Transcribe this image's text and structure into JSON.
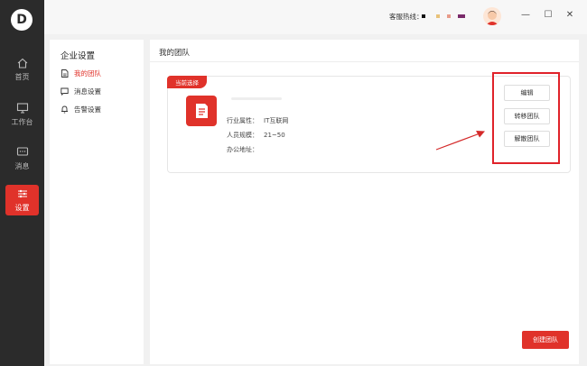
{
  "nav": {
    "items": [
      {
        "label": "首页"
      },
      {
        "label": "工作台"
      },
      {
        "label": "消息"
      },
      {
        "label": "设置"
      }
    ]
  },
  "topbar": {
    "hotline_label": "客服热线：",
    "colors": [
      "#111111",
      "#e8c27a",
      "#e89b8a",
      "#7a2a6a"
    ]
  },
  "subnav": {
    "title": "企业设置",
    "items": [
      {
        "label": "我的团队"
      },
      {
        "label": "消息设置"
      },
      {
        "label": "告警设置"
      }
    ]
  },
  "main": {
    "title": "我的团队",
    "card": {
      "tag": "当前选择",
      "industry_label": "行业属性：",
      "industry_value": "IT互联网",
      "size_label": "人员规模：",
      "size_value": "21~50",
      "address_label": "办公地址："
    },
    "actions": {
      "edit": "编辑",
      "transfer": "转移团队",
      "dissolve": "解散团队"
    },
    "create_button": "创建团队"
  },
  "theme": {
    "accent": "#e0322a",
    "sidebar_bg": "#2b2b2b"
  }
}
